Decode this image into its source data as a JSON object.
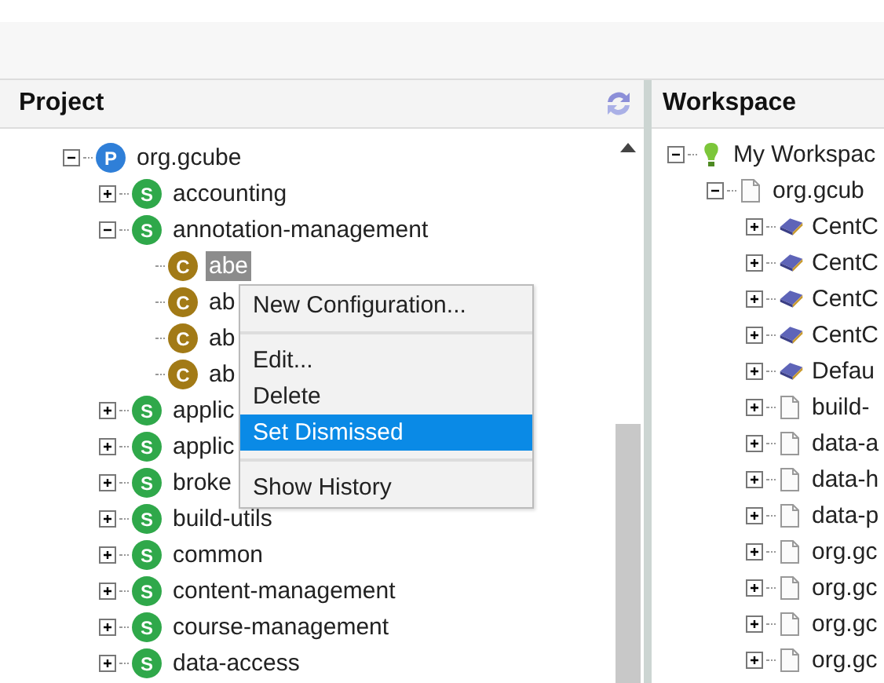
{
  "project": {
    "title": "Project",
    "tree": [
      {
        "label": "org.gcube",
        "kind": "p",
        "badge": "P",
        "expanded": true,
        "selected": false,
        "children": [
          {
            "label": "accounting",
            "kind": "s",
            "badge": "S",
            "expanded": false,
            "selected": false
          },
          {
            "label": "annotation-management",
            "kind": "s",
            "badge": "S",
            "expanded": true,
            "selected": false,
            "children": [
              {
                "label": "abe",
                "kind": "c",
                "badge": "C",
                "selected": true
              },
              {
                "label": "ab",
                "kind": "c",
                "badge": "C",
                "selected": false
              },
              {
                "label": "ab",
                "kind": "c",
                "badge": "C",
                "selected": false
              },
              {
                "label": "ab",
                "kind": "c",
                "badge": "C",
                "selected": false
              }
            ]
          },
          {
            "label": "applic",
            "kind": "s",
            "badge": "S",
            "expanded": false,
            "selected": false
          },
          {
            "label": "applic",
            "kind": "s",
            "badge": "S",
            "expanded": false,
            "selected": false
          },
          {
            "label": "broke",
            "kind": "s",
            "badge": "S",
            "expanded": false,
            "selected": false
          },
          {
            "label": "build-utils",
            "kind": "s",
            "badge": "S",
            "expanded": false,
            "selected": false
          },
          {
            "label": "common",
            "kind": "s",
            "badge": "S",
            "expanded": false,
            "selected": false
          },
          {
            "label": "content-management",
            "kind": "s",
            "badge": "S",
            "expanded": false,
            "selected": false
          },
          {
            "label": "course-management",
            "kind": "s",
            "badge": "S",
            "expanded": false,
            "selected": false
          },
          {
            "label": "data-access",
            "kind": "s",
            "badge": "S",
            "expanded": false,
            "selected": false
          }
        ]
      }
    ]
  },
  "context_menu": [
    {
      "kind": "item",
      "label": "New Configuration...",
      "selected": false
    },
    {
      "kind": "separator"
    },
    {
      "kind": "item",
      "label": "Edit...",
      "selected": false
    },
    {
      "kind": "item",
      "label": "Delete",
      "selected": false
    },
    {
      "kind": "item",
      "label": "Set Dismissed",
      "selected": true
    },
    {
      "kind": "separator"
    },
    {
      "kind": "item",
      "label": "Show History",
      "selected": false
    }
  ],
  "workspace": {
    "title": "Workspace",
    "tree": [
      {
        "label": "My Workspac",
        "kind": "workspace",
        "expanded": true,
        "children": [
          {
            "label": "org.gcub",
            "kind": "file",
            "expanded": true,
            "children": [
              {
                "label": "CentC",
                "kind": "module",
                "expanded": false
              },
              {
                "label": "CentC",
                "kind": "module",
                "expanded": false
              },
              {
                "label": "CentC",
                "kind": "module",
                "expanded": false
              },
              {
                "label": "CentC",
                "kind": "module",
                "expanded": false
              },
              {
                "label": "Defau",
                "kind": "module",
                "expanded": false
              },
              {
                "label": "build-",
                "kind": "file",
                "expanded": false
              },
              {
                "label": "data-a",
                "kind": "file",
                "expanded": false
              },
              {
                "label": "data-h",
                "kind": "file",
                "expanded": false
              },
              {
                "label": "data-p",
                "kind": "file",
                "expanded": false
              },
              {
                "label": "org.gc",
                "kind": "file",
                "expanded": false
              },
              {
                "label": "org.gc",
                "kind": "file",
                "expanded": false
              },
              {
                "label": "org.gc",
                "kind": "file",
                "expanded": false
              },
              {
                "label": "org.gc",
                "kind": "file",
                "expanded": false
              }
            ]
          }
        ]
      }
    ]
  }
}
